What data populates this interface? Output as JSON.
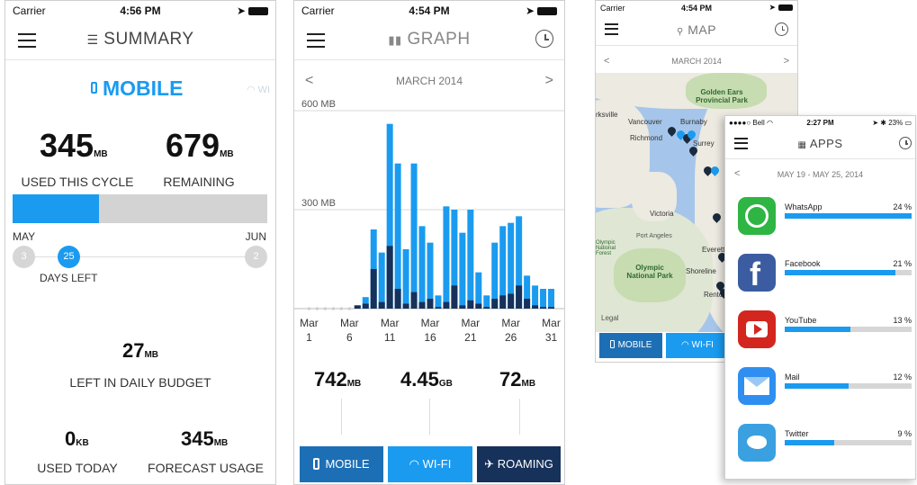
{
  "colors": {
    "accent": "#1a9bf0",
    "dark_tab": "#16315a",
    "map_water": "#a6c5ea",
    "map_land": "#eceae1"
  },
  "summary": {
    "status": {
      "carrier": "Carrier",
      "time": "4:56 PM"
    },
    "title": "SUMMARY",
    "tab_mobile": "MOBILE",
    "tab_wifi": "WI",
    "used": {
      "value": "345",
      "unit": "MB",
      "label": "USED THIS CYCLE"
    },
    "remaining": {
      "value": "679",
      "unit": "MB",
      "label": "REMAINING"
    },
    "cycle_progress": 0.34,
    "start_month": "MAY",
    "end_month": "JUN",
    "day_start": "3",
    "day_current": "25",
    "day_end": "2",
    "days_left_label": "DAYS LEFT",
    "daily_budget": {
      "value": "27",
      "unit": "MB",
      "label": "LEFT IN DAILY BUDGET"
    },
    "today": {
      "value": "0",
      "unit": "KB",
      "label": "USED TODAY"
    },
    "forecast": {
      "value": "345",
      "unit": "MB",
      "label": "FORECAST USAGE"
    }
  },
  "graph": {
    "status": {
      "carrier": "Carrier",
      "time": "4:54 PM"
    },
    "title": "GRAPH",
    "prev": "<",
    "next": ">",
    "month": "MARCH 2014",
    "totals": [
      {
        "value": "742",
        "unit": "MB"
      },
      {
        "value": "4.45",
        "unit": "GB"
      },
      {
        "value": "72",
        "unit": "MB"
      }
    ],
    "tabs": {
      "mobile": "MOBILE",
      "wifi": "WI-FI",
      "roaming": "ROAMING"
    }
  },
  "chart_data": {
    "type": "bar",
    "ylabels": [
      "600 MB",
      "300 MB"
    ],
    "gridlines": [
      600,
      300
    ],
    "ylim": [
      0,
      600
    ],
    "x_ticks": [
      {
        "month": "Mar",
        "day": "1"
      },
      {
        "month": "Mar",
        "day": "6"
      },
      {
        "month": "Mar",
        "day": "11"
      },
      {
        "month": "Mar",
        "day": "16"
      },
      {
        "month": "Mar",
        "day": "21"
      },
      {
        "month": "Mar",
        "day": "26"
      },
      {
        "month": "Mar",
        "day": "31"
      }
    ],
    "days": [
      1,
      2,
      3,
      4,
      5,
      6,
      7,
      8,
      9,
      10,
      11,
      12,
      13,
      14,
      15,
      16,
      17,
      18,
      19,
      20,
      21,
      22,
      23,
      24,
      25,
      26,
      27,
      28,
      29,
      30,
      31
    ],
    "series": [
      {
        "color": "#1a9bf0",
        "values": [
          0,
          0,
          0,
          0,
          0,
          0,
          10,
          35,
          240,
          170,
          560,
          440,
          180,
          440,
          250,
          200,
          40,
          310,
          300,
          230,
          300,
          110,
          40,
          200,
          250,
          260,
          280,
          100,
          70,
          60,
          60
        ]
      },
      {
        "color": "#16315a",
        "values": [
          0,
          0,
          0,
          0,
          0,
          0,
          10,
          15,
          120,
          20,
          190,
          60,
          15,
          50,
          20,
          30,
          5,
          20,
          70,
          10,
          25,
          15,
          5,
          30,
          40,
          45,
          70,
          30,
          10,
          5,
          5
        ]
      }
    ]
  },
  "map": {
    "status": {
      "carrier": "Carrier",
      "time": "4:54 PM"
    },
    "title": "MAP",
    "prev": "<",
    "next": ">",
    "month": "MARCH 2014",
    "places": [
      {
        "name": "Golden Ears Provincial Park",
        "style": "park"
      },
      {
        "name": "Vancouver",
        "style": "city"
      },
      {
        "name": "Burnaby",
        "style": "city"
      },
      {
        "name": "Richmond",
        "style": "city"
      },
      {
        "name": "Surrey",
        "style": "city"
      },
      {
        "name": "Victoria",
        "style": "city"
      },
      {
        "name": "Port Angeles",
        "style": "city"
      },
      {
        "name": "Olympic National Park",
        "style": "park"
      },
      {
        "name": "Olympic National Forest",
        "style": "park"
      },
      {
        "name": "Everett",
        "style": "city"
      },
      {
        "name": "Shoreline",
        "style": "city"
      },
      {
        "name": "Renton",
        "style": "city"
      },
      {
        "name": "rksville",
        "style": "city"
      },
      {
        "name": "Legal",
        "style": "legal"
      }
    ],
    "tabs": {
      "mobile": "MOBILE",
      "wifi": "WI-FI"
    }
  },
  "apps": {
    "status": {
      "carrier": "Bell",
      "time": "2:27 PM",
      "battery": "23%"
    },
    "title": "APPS",
    "prev": "<",
    "range": "MAY 19 - MAY 25, 2014",
    "items": [
      {
        "name": "WhatsApp",
        "percent": "24 %",
        "share": 1.0,
        "icon": "whatsapp-icon",
        "color": "#2fb544"
      },
      {
        "name": "Facebook",
        "percent": "21 %",
        "share": 0.87,
        "icon": "facebook-icon",
        "color": "#3b5ca0"
      },
      {
        "name": "YouTube",
        "percent": "13 %",
        "share": 0.52,
        "icon": "youtube-icon",
        "color": "#d3261f"
      },
      {
        "name": "Mail",
        "percent": "12 %",
        "share": 0.5,
        "icon": "mail-icon",
        "color": "#2f8ff0"
      },
      {
        "name": "Twitter",
        "percent": "9 %",
        "share": 0.39,
        "icon": "twitter-icon",
        "color": "#3aa0e0"
      }
    ]
  }
}
